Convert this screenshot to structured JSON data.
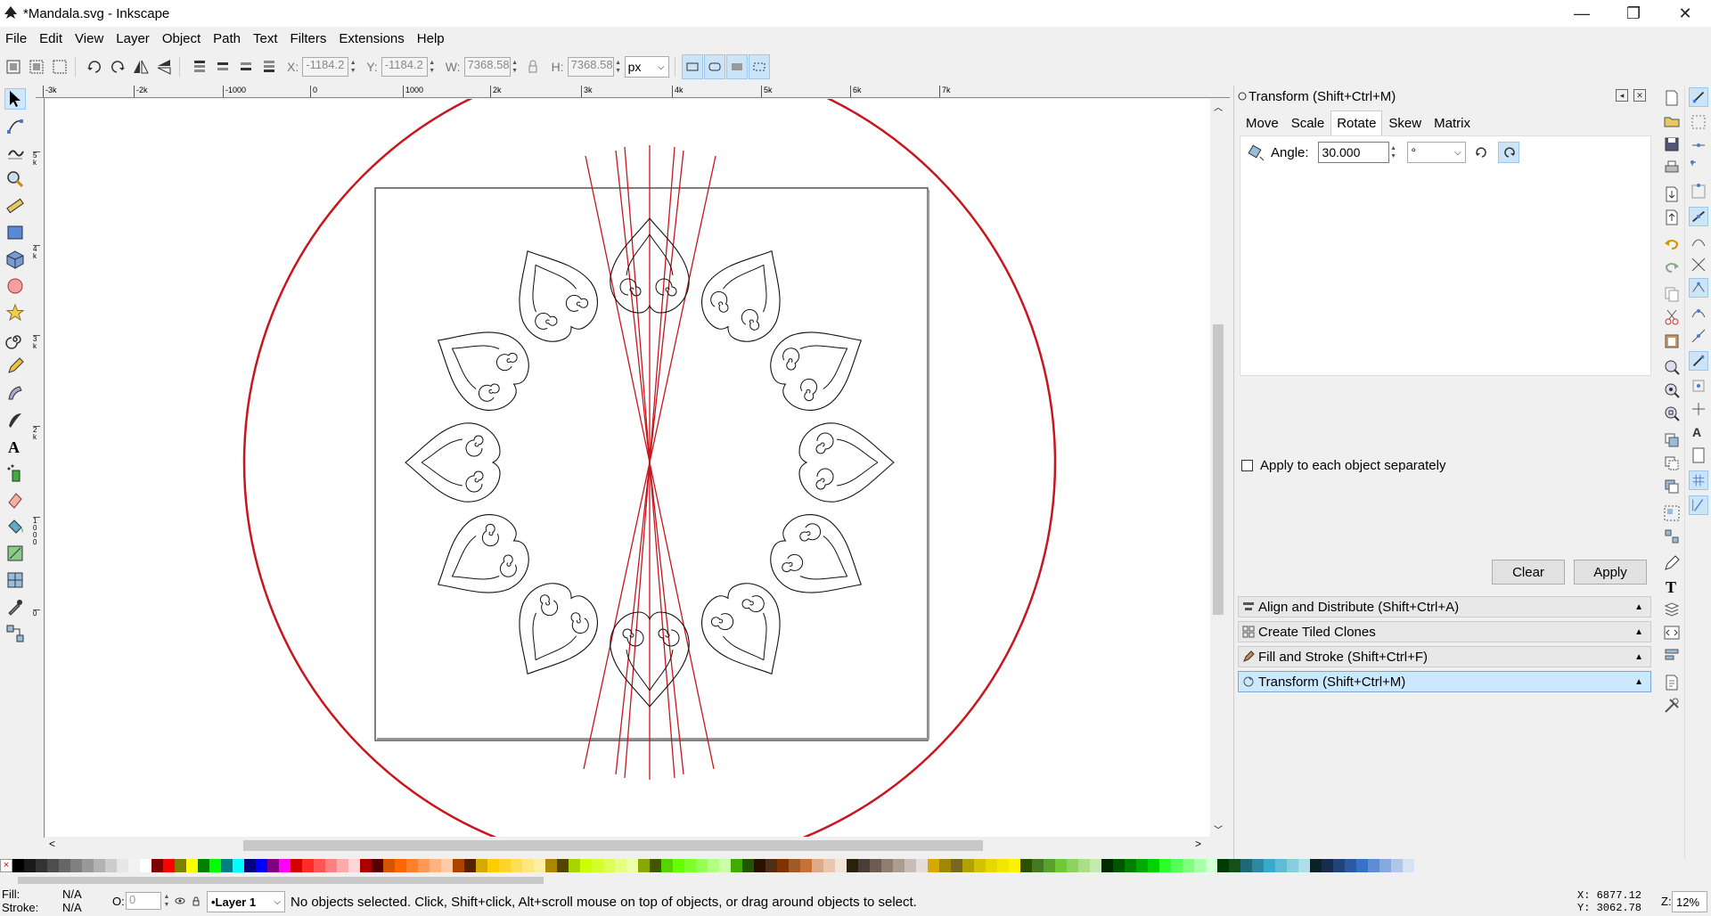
{
  "window": {
    "title": "*Mandala.svg - Inkscape",
    "minimize": "—",
    "maximize": "❐",
    "close": "✕"
  },
  "menu": [
    "File",
    "Edit",
    "View",
    "Layer",
    "Object",
    "Path",
    "Text",
    "Filters",
    "Extensions",
    "Help"
  ],
  "controls": {
    "x_label": "X:",
    "x_value": "-1184.2",
    "y_label": "Y:",
    "y_value": "-1184.2",
    "w_label": "W:",
    "w_value": "7368.58",
    "h_label": "H:",
    "h_value": "7368.58",
    "unit": "px"
  },
  "rulers": {
    "top_ticks": [
      "-3k",
      "-2k",
      "-1000",
      "0",
      "1000",
      "2k",
      "3k",
      "4k",
      "5k",
      "6k",
      "7k"
    ],
    "left_ticks": [
      "5k",
      "4k",
      "3k",
      "2k",
      "1000",
      "0"
    ]
  },
  "dialog": {
    "title": "Transform (Shift+Ctrl+M)",
    "tabs": [
      "Move",
      "Scale",
      "Rotate",
      "Skew",
      "Matrix"
    ],
    "active_tab": "Rotate",
    "angle_label": "Angle:",
    "angle_value": "30.000",
    "angle_unit": "°",
    "apply_each_label": "Apply to each object separately",
    "apply_each_checked": false,
    "clear_label": "Clear",
    "apply_label": "Apply",
    "docked": [
      {
        "label": "Align and Distribute (Shift+Ctrl+A)",
        "active": false
      },
      {
        "label": "Create Tiled Clones",
        "active": false
      },
      {
        "label": "Fill and Stroke (Shift+Ctrl+F)",
        "active": false
      },
      {
        "label": "Transform (Shift+Ctrl+M)",
        "active": true
      }
    ]
  },
  "palette": [
    "#000000",
    "#1a1a1a",
    "#333333",
    "#4d4d4d",
    "#666666",
    "#808080",
    "#999999",
    "#b3b3b3",
    "#cccccc",
    "#e6e6e6",
    "#f2f2f2",
    "#ffffff",
    "#800000",
    "#ff0000",
    "#808000",
    "#ffff00",
    "#008000",
    "#00ff00",
    "#008080",
    "#00ffff",
    "#000080",
    "#0000ff",
    "#800080",
    "#ff00ff",
    "#d40000",
    "#ff2a2a",
    "#ff5555",
    "#ff8080",
    "#ffaaaa",
    "#ffd5d5",
    "#aa0000",
    "#550000",
    "#d45500",
    "#ff6600",
    "#ff7f2a",
    "#ff9955",
    "#ffb380",
    "#ffccaa",
    "#aa4400",
    "#552200",
    "#d4aa00",
    "#ffcc00",
    "#ffd42a",
    "#ffdd55",
    "#ffe680",
    "#ffeeaa",
    "#aa8800",
    "#554400",
    "#aad400",
    "#ccff00",
    "#d4ff2a",
    "#ddff55",
    "#e5ff80",
    "#eeffaa",
    "#88aa00",
    "#445500",
    "#55d400",
    "#66ff00",
    "#7fff2a",
    "#99ff55",
    "#b3ff80",
    "#ccffaa",
    "#44aa00",
    "#225500"
  ],
  "status": {
    "fill_label": "Fill:",
    "fill_value": "N/A",
    "stroke_label": "Stroke:",
    "stroke_value": "N/A",
    "opacity_label": "O:",
    "opacity_value": "0",
    "layer": "•Layer 1",
    "message": "No objects selected. Click, Shift+click, Alt+scroll mouse on top of objects, or drag around objects to select.",
    "x_coord": "X: 6877.12",
    "y_coord": "Y: 3062.78",
    "zoom_label": "Z:",
    "zoom_value": "12%"
  }
}
